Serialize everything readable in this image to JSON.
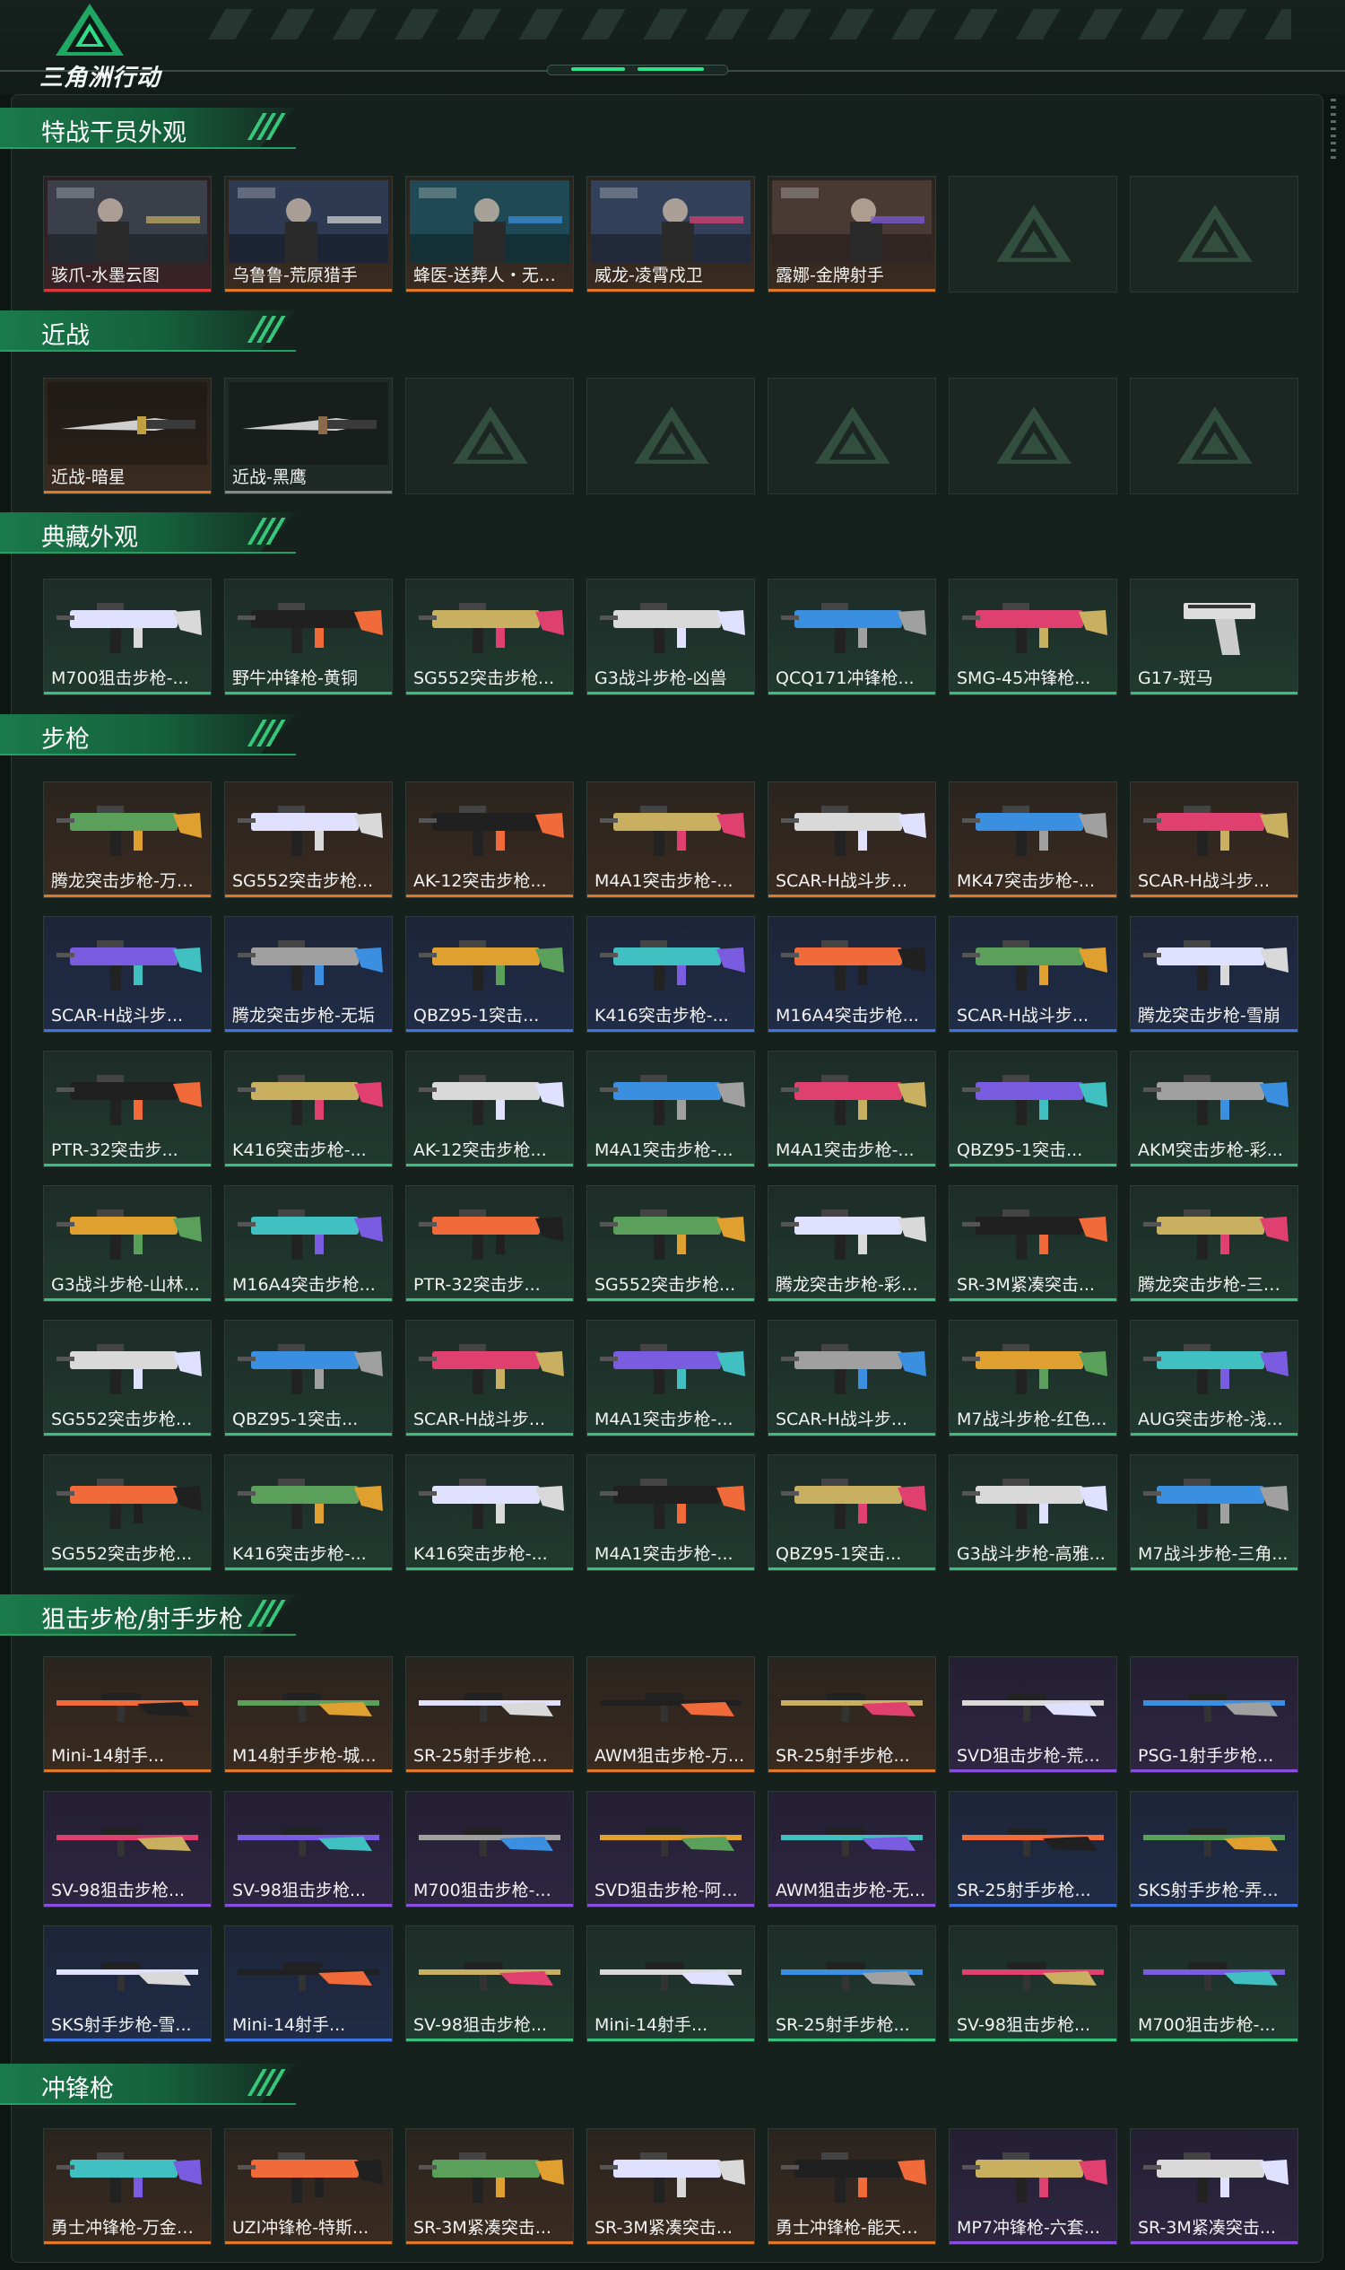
{
  "app": {
    "logo_text": "三角洲行动",
    "logo_icon": "delta-triangle-icon"
  },
  "sections": [
    {
      "title": "特战干员外观",
      "items": [
        {
          "name": "骇爪-水墨云图",
          "rarity": "red",
          "art": "banner"
        },
        {
          "name": "乌鲁鲁-荒原猎手",
          "rarity": "orange",
          "art": "banner"
        },
        {
          "name": "蜂医-送葬人・无题...",
          "rarity": "orange",
          "art": "banner"
        },
        {
          "name": "威龙-凌霄戍卫",
          "rarity": "orange",
          "art": "banner"
        },
        {
          "name": "露娜-金牌射手",
          "rarity": "orange",
          "art": "banner"
        },
        {
          "name": "",
          "rarity": "empty"
        },
        {
          "name": "",
          "rarity": "empty"
        }
      ]
    },
    {
      "title": "近战",
      "items": [
        {
          "name": "近战-暗星",
          "rarity": "orange",
          "art": "knife"
        },
        {
          "name": "近战-黑鹰",
          "rarity": "gray",
          "art": "knife"
        },
        {
          "name": "",
          "rarity": "empty"
        },
        {
          "name": "",
          "rarity": "empty"
        },
        {
          "name": "",
          "rarity": "empty"
        },
        {
          "name": "",
          "rarity": "empty"
        },
        {
          "name": "",
          "rarity": "empty"
        }
      ]
    },
    {
      "title": "典藏外观",
      "items": [
        {
          "name": "M700狙击步枪-...",
          "rarity": "green",
          "art": "rifle"
        },
        {
          "name": "野牛冲锋枪-黄铜",
          "rarity": "green",
          "art": "smg"
        },
        {
          "name": "SG552突击步枪...",
          "rarity": "green",
          "art": "smg"
        },
        {
          "name": "G3战斗步枪-凶兽",
          "rarity": "green",
          "art": "rifle"
        },
        {
          "name": "QCQ171冲锋枪...",
          "rarity": "green",
          "art": "smg"
        },
        {
          "name": "SMG-45冲锋枪...",
          "rarity": "green",
          "art": "smg"
        },
        {
          "name": "G17-斑马",
          "rarity": "green",
          "art": "pistol"
        }
      ]
    },
    {
      "title": "步枪",
      "items": [
        {
          "name": "腾龙突击步枪-万金...",
          "rarity": "orange",
          "art": "rifle"
        },
        {
          "name": "SG552突击步枪...",
          "rarity": "orange",
          "art": "rifle"
        },
        {
          "name": "AK-12突击步枪...",
          "rarity": "orange",
          "art": "rifle"
        },
        {
          "name": "M4A1突击步枪-...",
          "rarity": "orange",
          "art": "rifle"
        },
        {
          "name": "SCAR-H战斗步...",
          "rarity": "orange",
          "art": "rifle"
        },
        {
          "name": "MK47突击步枪-...",
          "rarity": "orange",
          "art": "rifle"
        },
        {
          "name": "SCAR-H战斗步...",
          "rarity": "orange",
          "art": "rifle"
        },
        {
          "name": "SCAR-H战斗步...",
          "rarity": "blue",
          "art": "rifle"
        },
        {
          "name": "腾龙突击步枪-无垢",
          "rarity": "blue",
          "art": "rifle"
        },
        {
          "name": "QBZ95-1突击...",
          "rarity": "blue",
          "art": "rifle"
        },
        {
          "name": "K416突击步枪-...",
          "rarity": "blue",
          "art": "rifle"
        },
        {
          "name": "M16A4突击步枪...",
          "rarity": "blue",
          "art": "rifle"
        },
        {
          "name": "SCAR-H战斗步...",
          "rarity": "blue",
          "art": "rifle"
        },
        {
          "name": "腾龙突击步枪-雪崩",
          "rarity": "blue",
          "art": "rifle"
        },
        {
          "name": "PTR-32突击步...",
          "rarity": "green",
          "art": "rifle"
        },
        {
          "name": "K416突击步枪-...",
          "rarity": "green",
          "art": "rifle"
        },
        {
          "name": "AK-12突击步枪...",
          "rarity": "green",
          "art": "rifle"
        },
        {
          "name": "M4A1突击步枪-...",
          "rarity": "green",
          "art": "rifle"
        },
        {
          "name": "M4A1突击步枪-...",
          "rarity": "green",
          "art": "rifle"
        },
        {
          "name": "QBZ95-1突击...",
          "rarity": "green",
          "art": "rifle"
        },
        {
          "name": "AKM突击步枪-彩...",
          "rarity": "green",
          "art": "rifle"
        },
        {
          "name": "G3战斗步枪-山林...",
          "rarity": "green",
          "art": "rifle"
        },
        {
          "name": "M16A4突击步枪...",
          "rarity": "green",
          "art": "rifle"
        },
        {
          "name": "PTR-32突击步...",
          "rarity": "green",
          "art": "rifle"
        },
        {
          "name": "SG552突击步枪...",
          "rarity": "green",
          "art": "rifle"
        },
        {
          "name": "腾龙突击步枪-彩墨...",
          "rarity": "green",
          "art": "rifle"
        },
        {
          "name": "SR-3M紧凑突击...",
          "rarity": "green",
          "art": "rifle"
        },
        {
          "name": "腾龙突击步枪-三角...",
          "rarity": "green",
          "art": "rifle"
        },
        {
          "name": "SG552突击步枪...",
          "rarity": "green",
          "art": "rifle"
        },
        {
          "name": "QBZ95-1突击...",
          "rarity": "green",
          "art": "rifle"
        },
        {
          "name": "SCAR-H战斗步...",
          "rarity": "green",
          "art": "rifle"
        },
        {
          "name": "M4A1突击步枪-...",
          "rarity": "green",
          "art": "rifle"
        },
        {
          "name": "SCAR-H战斗步...",
          "rarity": "green",
          "art": "rifle"
        },
        {
          "name": "M7战斗步枪-红色...",
          "rarity": "green",
          "art": "rifle"
        },
        {
          "name": "AUG突击步枪-浅...",
          "rarity": "green",
          "art": "rifle"
        },
        {
          "name": "SG552突击步枪...",
          "rarity": "green",
          "art": "rifle"
        },
        {
          "name": "K416突击步枪-...",
          "rarity": "green",
          "art": "rifle"
        },
        {
          "name": "K416突击步枪-...",
          "rarity": "green",
          "art": "rifle"
        },
        {
          "name": "M4A1突击步枪-...",
          "rarity": "green",
          "art": "rifle"
        },
        {
          "name": "QBZ95-1突击...",
          "rarity": "green",
          "art": "rifle"
        },
        {
          "name": "G3战斗步枪-高雅...",
          "rarity": "green",
          "art": "rifle"
        },
        {
          "name": "M7战斗步枪-三角...",
          "rarity": "green",
          "art": "rifle"
        }
      ]
    },
    {
      "title": "狙击步枪/射手步枪",
      "items": [
        {
          "name": "Mini-14射手...",
          "rarity": "orange",
          "art": "sniper"
        },
        {
          "name": "M14射手步枪-城...",
          "rarity": "orange",
          "art": "sniper"
        },
        {
          "name": "SR-25射手步枪...",
          "rarity": "orange",
          "art": "sniper"
        },
        {
          "name": "AWM狙击步枪-万...",
          "rarity": "orange",
          "art": "sniper"
        },
        {
          "name": "SR-25射手步枪...",
          "rarity": "orange",
          "art": "sniper"
        },
        {
          "name": "SVD狙击步枪-荒...",
          "rarity": "purple",
          "art": "sniper"
        },
        {
          "name": "PSG-1射手步枪...",
          "rarity": "purple",
          "art": "sniper"
        },
        {
          "name": "SV-98狙击步枪...",
          "rarity": "purple",
          "art": "sniper"
        },
        {
          "name": "SV-98狙击步枪...",
          "rarity": "purple",
          "art": "sniper"
        },
        {
          "name": "M700狙击步枪-...",
          "rarity": "purple",
          "art": "sniper"
        },
        {
          "name": "SVD狙击步枪-阿...",
          "rarity": "purple",
          "art": "sniper"
        },
        {
          "name": "AWM狙击步枪-无...",
          "rarity": "purple",
          "art": "sniper"
        },
        {
          "name": "SR-25射手步枪...",
          "rarity": "blue",
          "art": "sniper"
        },
        {
          "name": "SKS射手步枪-弄...",
          "rarity": "blue",
          "art": "sniper"
        },
        {
          "name": "SKS射手步枪-雪...",
          "rarity": "blue",
          "art": "sniper"
        },
        {
          "name": "Mini-14射手...",
          "rarity": "blue",
          "art": "sniper"
        },
        {
          "name": "SV-98狙击步枪...",
          "rarity": "green",
          "art": "sniper"
        },
        {
          "name": "Mini-14射手...",
          "rarity": "green",
          "art": "sniper"
        },
        {
          "name": "SR-25射手步枪...",
          "rarity": "green",
          "art": "sniper"
        },
        {
          "name": "SV-98狙击步枪...",
          "rarity": "green",
          "art": "sniper"
        },
        {
          "name": "M700狙击步枪-...",
          "rarity": "green",
          "art": "sniper"
        }
      ]
    },
    {
      "title": "冲锋枪",
      "items": [
        {
          "name": "勇士冲锋枪-万金泪...",
          "rarity": "orange",
          "art": "smg"
        },
        {
          "name": "UZI冲锋枪-特斯...",
          "rarity": "orange",
          "art": "smg"
        },
        {
          "name": "SR-3M紧凑突击...",
          "rarity": "orange",
          "art": "smg"
        },
        {
          "name": "SR-3M紧凑突击...",
          "rarity": "orange",
          "art": "smg"
        },
        {
          "name": "勇士冲锋枪-能天使...",
          "rarity": "orange",
          "art": "smg"
        },
        {
          "name": "MP7冲锋枪-六套...",
          "rarity": "purple",
          "art": "smg"
        },
        {
          "name": "SR-3M紧凑突击...",
          "rarity": "purple",
          "art": "smg"
        }
      ]
    }
  ],
  "colors": {
    "accent": "#2ee08a",
    "red": "#d93a3a",
    "orange": "#e0782a",
    "purple": "#8a4fe0",
    "blue": "#3c74e8",
    "green": "#39c07c",
    "gray": "#888888"
  }
}
